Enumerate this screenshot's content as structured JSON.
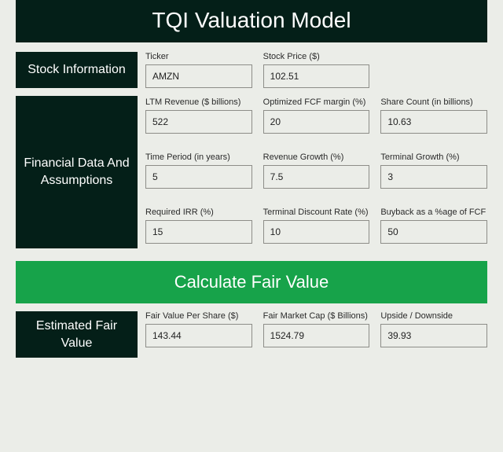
{
  "title": "TQI Valuation Model",
  "sections": {
    "stock": {
      "label": "Stock Information",
      "fields": {
        "ticker": {
          "label": "Ticker",
          "value": "AMZN"
        },
        "price": {
          "label": "Stock Price ($)",
          "value": "102.51"
        }
      }
    },
    "financial": {
      "label": "Financial Data And Assumptions",
      "fields": {
        "ltm_revenue": {
          "label": "LTM Revenue ($ billions)",
          "value": "522"
        },
        "fcf_margin": {
          "label": "Optimized FCF margin (%)",
          "value": "20"
        },
        "share_count": {
          "label": "Share Count (in billions)",
          "value": "10.63"
        },
        "time_period": {
          "label": "Time Period (in years)",
          "value": "5"
        },
        "rev_growth": {
          "label": "Revenue Growth (%)",
          "value": "7.5"
        },
        "term_growth": {
          "label": "Terminal Growth (%)",
          "value": "3"
        },
        "req_irr": {
          "label": "Required IRR (%)",
          "value": "15"
        },
        "term_disc": {
          "label": "Terminal Discount Rate (%)",
          "value": "10"
        },
        "buyback": {
          "label": "Buyback as a %age of FCF",
          "value": "50"
        }
      }
    },
    "estimated": {
      "label": "Estimated Fair Value",
      "fields": {
        "fv_share": {
          "label": "Fair Value Per Share ($)",
          "value": "143.44"
        },
        "fv_mktcap": {
          "label": "Fair Market Cap ($ Billions)",
          "value": "1524.79"
        },
        "upside": {
          "label": "Upside / Downside",
          "value": "39.93"
        }
      }
    }
  },
  "calc_button": "Calculate Fair Value"
}
